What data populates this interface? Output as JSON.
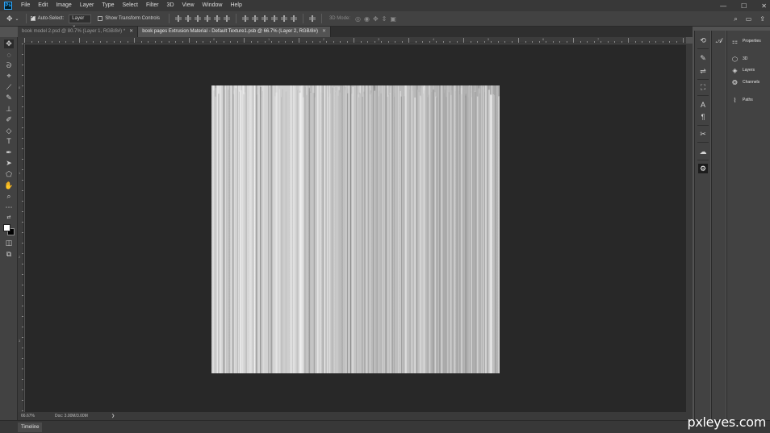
{
  "app": {
    "logo": "Ps"
  },
  "menu": [
    "File",
    "Edit",
    "Image",
    "Layer",
    "Type",
    "Select",
    "Filter",
    "3D",
    "View",
    "Window",
    "Help"
  ],
  "window_controls": {
    "minimize": "—",
    "maximize": "☐",
    "close": "✕"
  },
  "options": {
    "auto_select_label": "Auto-Select:",
    "auto_select_target": "Layer",
    "transform_controls_label": "Show Transform Controls",
    "mode_3d_label": "3D Mode:"
  },
  "tabs": [
    {
      "label": "book model 2.psd @ 80.7% (Layer 1, RGB/8#) *",
      "close": "✕"
    },
    {
      "label": "book pages Extrusion Material - Default Texture1.psb @ 66.7% (Layer 2, RGB/8#)",
      "close": "✕"
    }
  ],
  "ruler_numbers": {
    "top": [
      "0",
      "1",
      "2",
      "3",
      "4",
      "5",
      "6",
      "7"
    ],
    "left": [
      "0",
      "1",
      "2",
      "3"
    ]
  },
  "status": {
    "zoom": "66.67%",
    "doc_info": "Doc: 3.00M/3.00M",
    "arrow": "❯"
  },
  "timeline": {
    "label": "Timeline"
  },
  "panels": [
    {
      "icon": "cube-icon",
      "label": "3D"
    },
    {
      "icon": "layers-icon",
      "label": "Layers"
    },
    {
      "icon": "channels-icon",
      "label": "Channels"
    },
    {
      "icon": "paths-icon",
      "label": "Paths"
    }
  ],
  "properties_panel": {
    "label": "Properties"
  },
  "canvas": {
    "texture": "brushed-metal",
    "base_color": "#c8c8c8"
  },
  "watermark": {
    "text": "pxleyes.com"
  }
}
